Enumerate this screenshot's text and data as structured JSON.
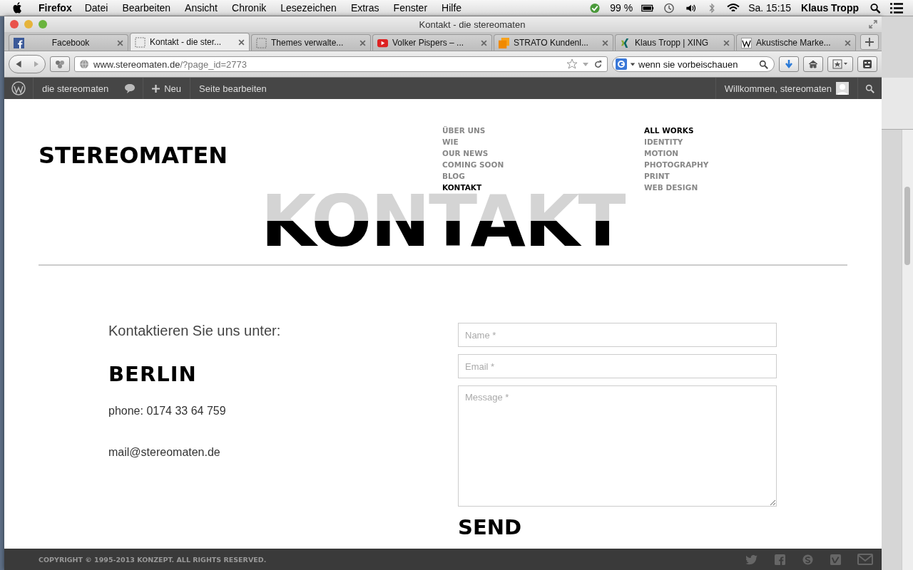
{
  "menubar": {
    "app": "Firefox",
    "menus": [
      "Datei",
      "Bearbeiten",
      "Ansicht",
      "Chronik",
      "Lesezeichen",
      "Extras",
      "Fenster",
      "Hilfe"
    ],
    "battery": "99 %",
    "clock": "Sa. 15:15",
    "user": "Klaus Tropp"
  },
  "window": {
    "title": "Kontakt - die stereomaten"
  },
  "tabs": [
    {
      "label": "Facebook",
      "selected": false,
      "kind": "fb"
    },
    {
      "label": "Kontakt - die ster...",
      "selected": true,
      "kind": "blank"
    },
    {
      "label": "Themes verwalte...",
      "selected": false,
      "kind": "blank"
    },
    {
      "label": "Volker Pispers – ...",
      "selected": false,
      "kind": "yt"
    },
    {
      "label": "STRATO Kundenl...",
      "selected": false,
      "kind": "strato"
    },
    {
      "label": "Klaus Tropp | XING",
      "selected": false,
      "kind": "xing"
    },
    {
      "label": "Akustische Marke...",
      "selected": false,
      "kind": "wiki"
    }
  ],
  "url": {
    "host": "www.stereomaten.de",
    "path": "/?page_id=2773"
  },
  "search": {
    "value": "wenn sie vorbeischauen"
  },
  "adminbar": {
    "site": "die stereomaten",
    "new": "Neu",
    "edit": "Seite bearbeiten",
    "welcome": "Willkommen, stereomaten"
  },
  "site": {
    "logo": "STEREOMATEN",
    "nav": [
      {
        "label": "ÜBER UNS",
        "selected": false
      },
      {
        "label": "WIE",
        "selected": false
      },
      {
        "label": "OUR NEWS",
        "selected": false
      },
      {
        "label": "COMING SOON",
        "selected": false
      },
      {
        "label": "BLOG",
        "selected": false
      },
      {
        "label": "KONTAKT",
        "selected": true
      }
    ],
    "works": [
      {
        "label": "ALL WORKS",
        "selected": true
      },
      {
        "label": "IDENTITY",
        "selected": false
      },
      {
        "label": "MOTION",
        "selected": false
      },
      {
        "label": "PHOTOGRAPHY",
        "selected": false
      },
      {
        "label": "PRINT",
        "selected": false
      },
      {
        "label": "WEB DESIGN",
        "selected": false
      }
    ],
    "heading": "KONTAKT"
  },
  "contact": {
    "intro": "Kontaktieren Sie uns unter:",
    "city": "BERLIN",
    "phone": "phone: 0174 33 64 759",
    "mail": "mail@stereomaten.de"
  },
  "form": {
    "name": {
      "placeholder": "Name *"
    },
    "email": {
      "placeholder": "Email *"
    },
    "message": {
      "placeholder": "Message *"
    },
    "send": "SEND"
  },
  "footer": {
    "copyright": "COPYRIGHT © 1995-2013 KONZEPT. ALL RIGHTS RESERVED."
  }
}
